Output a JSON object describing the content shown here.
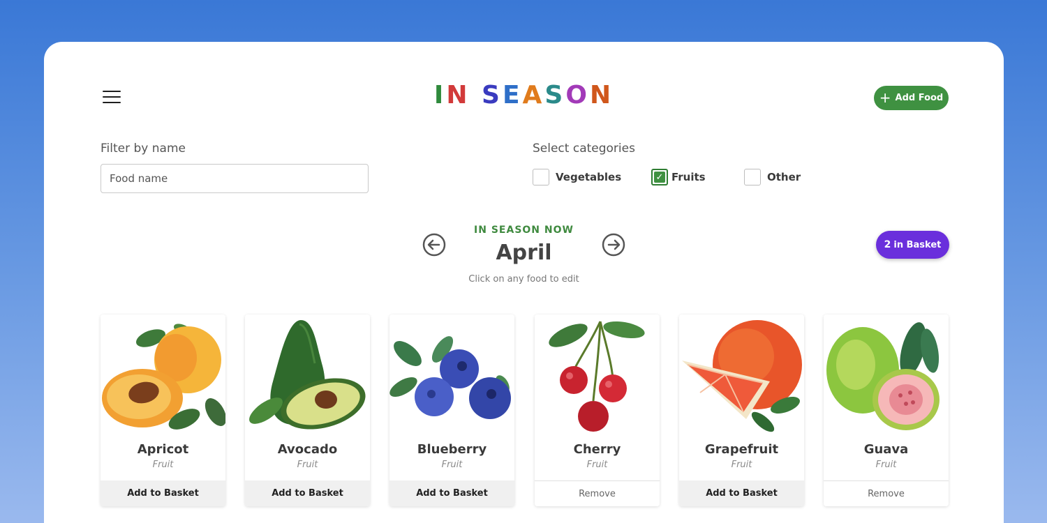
{
  "app": {
    "logo_letters": [
      {
        "ch": "I",
        "color": "#2f8a3c"
      },
      {
        "ch": "N",
        "color": "#d23a3a"
      },
      {
        "ch": " ",
        "color": "#000000"
      },
      {
        "ch": "S",
        "color": "#3a3bbf"
      },
      {
        "ch": "E",
        "color": "#2f6fc8"
      },
      {
        "ch": "A",
        "color": "#e07b1c"
      },
      {
        "ch": "S",
        "color": "#2b8a8a"
      },
      {
        "ch": "O",
        "color": "#a23ab8"
      },
      {
        "ch": "N",
        "color": "#d0571c"
      }
    ],
    "add_food_label": "Add Food",
    "menu_icon": "hamburger-icon",
    "add_icon": "plus-icon"
  },
  "filter": {
    "label": "Filter by name",
    "placeholder": "Food name",
    "value": ""
  },
  "categories": {
    "label": "Select categories",
    "items": [
      {
        "label": "Vegetables",
        "checked": false
      },
      {
        "label": "Fruits",
        "checked": true
      },
      {
        "label": "Other",
        "checked": false
      }
    ]
  },
  "season": {
    "heading": "IN SEASON NOW",
    "month": "April",
    "hint": "Click on any food to edit",
    "prev_icon": "arrow-left-circle-icon",
    "next_icon": "arrow-right-circle-icon"
  },
  "basket": {
    "count": "2",
    "label": "in Basket"
  },
  "colors": {
    "primary_green": "#3f9141",
    "basket_purple": "#6a2fdc"
  },
  "foods": [
    {
      "name": "Apricot",
      "kind": "Fruit",
      "action": "Add to Basket",
      "in_basket": false
    },
    {
      "name": "Avocado",
      "kind": "Fruit",
      "action": "Add to Basket",
      "in_basket": false
    },
    {
      "name": "Blueberry",
      "kind": "Fruit",
      "action": "Add to Basket",
      "in_basket": false
    },
    {
      "name": "Cherry",
      "kind": "Fruit",
      "action": "Remove",
      "in_basket": true
    },
    {
      "name": "Grapefruit",
      "kind": "Fruit",
      "action": "Add to Basket",
      "in_basket": false
    },
    {
      "name": "Guava",
      "kind": "Fruit",
      "action": "Remove",
      "in_basket": true
    }
  ]
}
